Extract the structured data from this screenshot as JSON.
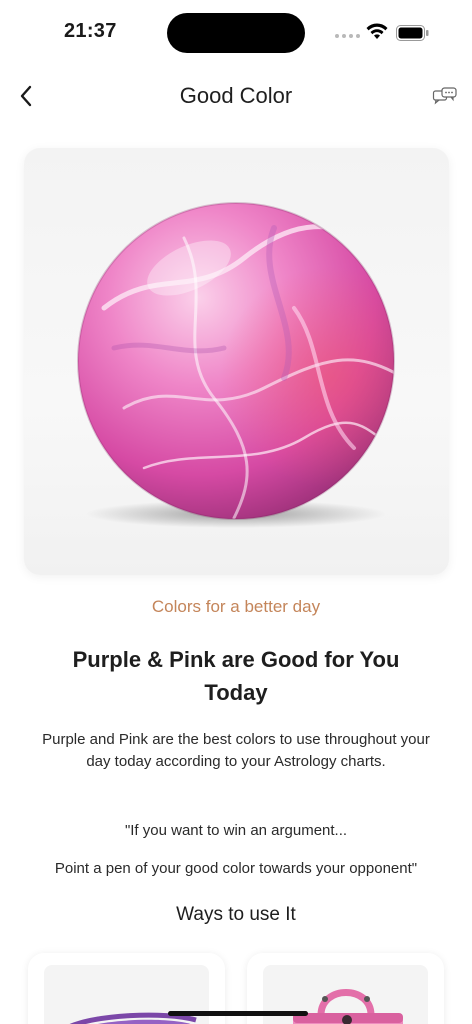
{
  "status_bar": {
    "time": "21:37"
  },
  "nav": {
    "title": "Good Color",
    "back_icon": "chevron-left-icon",
    "chat_icon": "chat-bubbles-icon"
  },
  "hero": {
    "image": "pink-marble-sphere",
    "colors": [
      "#e04ca6",
      "#f7a8d6",
      "#b3408a"
    ]
  },
  "content": {
    "subtitle": "Colors for a better day",
    "headline": "Purple & Pink are Good for You Today",
    "body": "Purple and Pink are the best colors to use throughout your day today according to your Astrology charts.",
    "quote_line_1": "\"If you want to win an argument...",
    "quote_line_2": "Point a pen of your good color towards your opponent\"",
    "section_title": "Ways to use It"
  },
  "products": [
    {
      "image": "purple-belt",
      "color": "#8a55b8"
    },
    {
      "image": "pink-handbag",
      "color": "#e87fb5"
    }
  ],
  "accent": {
    "subtitle_color": "#c4855a"
  }
}
